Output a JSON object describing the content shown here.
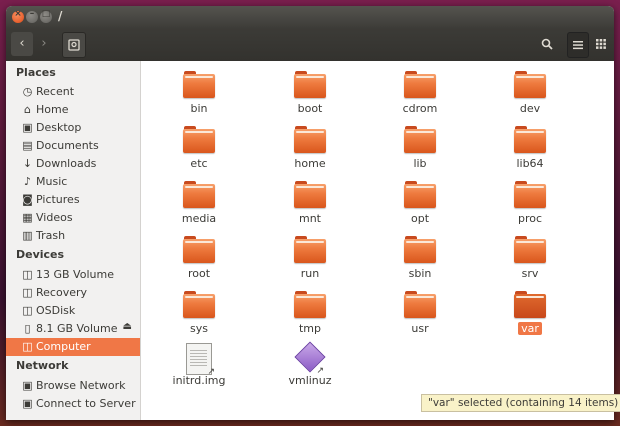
{
  "window": {
    "title": "/"
  },
  "toolbar": {
    "back_icon": "‹",
    "forward_icon": "›",
    "search_icon": "search-icon",
    "list_icon": "list-icon",
    "grid_icon": "grid-icon"
  },
  "sidebar": {
    "places_label": "Places",
    "places": [
      {
        "label": "Recent",
        "icon": "clock"
      },
      {
        "label": "Home",
        "icon": "home"
      },
      {
        "label": "Desktop",
        "icon": "desktop"
      },
      {
        "label": "Documents",
        "icon": "documents"
      },
      {
        "label": "Downloads",
        "icon": "downloads"
      },
      {
        "label": "Music",
        "icon": "music"
      },
      {
        "label": "Pictures",
        "icon": "pictures"
      },
      {
        "label": "Videos",
        "icon": "videos"
      },
      {
        "label": "Trash",
        "icon": "trash"
      }
    ],
    "devices_label": "Devices",
    "devices": [
      {
        "label": "13 GB Volume",
        "icon": "drive"
      },
      {
        "label": "Recovery",
        "icon": "drive"
      },
      {
        "label": "OSDisk",
        "icon": "drive"
      },
      {
        "label": "8.1 GB Volume",
        "icon": "usb"
      },
      {
        "label": "Computer",
        "icon": "computer",
        "active": true
      }
    ],
    "network_label": "Network",
    "network": [
      {
        "label": "Browse Network",
        "icon": "network"
      },
      {
        "label": "Connect to Server",
        "icon": "server"
      }
    ]
  },
  "files": [
    "bin",
    "boot",
    "cdrom",
    "dev",
    "etc",
    "home",
    "lib",
    "lib64",
    "media",
    "mnt",
    "opt",
    "proc",
    "root",
    "run",
    "sbin",
    "srv",
    "sys",
    "tmp",
    "usr",
    "var",
    "initrd.img",
    "vmlinuz"
  ],
  "selected": "var",
  "status": "\"var\" selected  (containing 14 items)",
  "colors": {
    "accent": "#f07746",
    "folder": "#ee7a3e",
    "titlebar": "#3c3b37"
  }
}
